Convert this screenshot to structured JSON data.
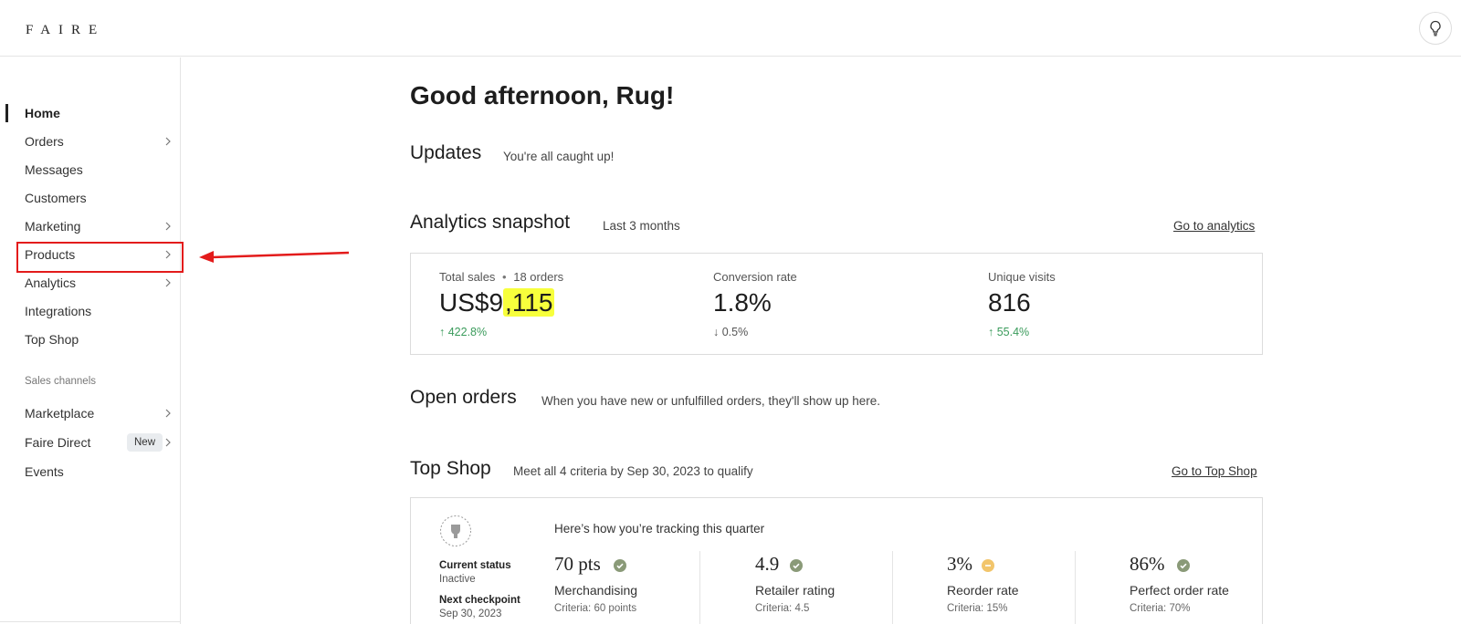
{
  "brand": {
    "logo": "FAIRE"
  },
  "header": {
    "tips_icon": "lightbulb-icon"
  },
  "sidebar": {
    "items": [
      {
        "label": "Home",
        "active": true,
        "has_chevron": false
      },
      {
        "label": "Orders",
        "has_chevron": true
      },
      {
        "label": "Messages",
        "has_chevron": false
      },
      {
        "label": "Customers",
        "has_chevron": false
      },
      {
        "label": "Marketing",
        "has_chevron": true
      },
      {
        "label": "Products",
        "has_chevron": true
      },
      {
        "label": "Analytics",
        "has_chevron": true
      },
      {
        "label": "Integrations",
        "has_chevron": false
      },
      {
        "label": "Top Shop",
        "has_chevron": false
      }
    ],
    "section_label": "Sales channels",
    "channels": [
      {
        "label": "Marketplace",
        "has_chevron": true
      },
      {
        "label": "Faire Direct",
        "badge": "New",
        "has_chevron": true
      },
      {
        "label": "Events",
        "has_chevron": false
      }
    ]
  },
  "main": {
    "greeting": "Good afternoon, Rug!",
    "updates": {
      "title": "Updates",
      "subtitle": "You're all caught up!"
    },
    "analytics": {
      "title": "Analytics snapshot",
      "subtitle": "Last 3 months",
      "link": "Go to analytics",
      "stats": [
        {
          "label": "Total sales",
          "extra": "18 orders",
          "value_prefix": "US$9",
          "value_highlight": ",115",
          "change": "↑ 422.8%",
          "direction": "up"
        },
        {
          "label": "Conversion rate",
          "value": "1.8%",
          "change": "↓ 0.5%",
          "direction": "down"
        },
        {
          "label": "Unique visits",
          "value": "816",
          "change": "↑ 55.4%",
          "direction": "up"
        }
      ]
    },
    "open_orders": {
      "title": "Open orders",
      "subtitle": "When you have new or unfulfilled orders, they'll show up here."
    },
    "top_shop": {
      "title": "Top Shop",
      "subtitle": "Meet all 4 criteria by Sep 30, 2023 to qualify",
      "link": "Go to Top Shop",
      "tracking": "Here’s how you’re tracking this quarter",
      "current_status_label": "Current status",
      "current_status_value": "Inactive",
      "next_checkpoint_label": "Next checkpoint",
      "next_checkpoint_value": "Sep 30, 2023",
      "metrics": [
        {
          "value": "70 pts",
          "label": "Merchandising",
          "criteria": "Criteria: 60 points",
          "status": "met",
          "status_color": "#8a9a78"
        },
        {
          "value": "4.9",
          "label": "Retailer rating",
          "criteria": "Criteria: 4.5",
          "status": "met",
          "status_color": "#8a9a78"
        },
        {
          "value": "3%",
          "label": "Reorder rate",
          "criteria": "Criteria: 15%",
          "status": "pending",
          "status_color": "#f2c56b"
        },
        {
          "value": "86%",
          "label": "Perfect order rate",
          "criteria": "Criteria: 70%",
          "status": "met",
          "status_color": "#8a9a78"
        }
      ]
    }
  },
  "colors": {
    "annotation_red": "#e31b1b",
    "positive_green": "#3a9b5b",
    "highlight_yellow": "#f7ff3c"
  }
}
